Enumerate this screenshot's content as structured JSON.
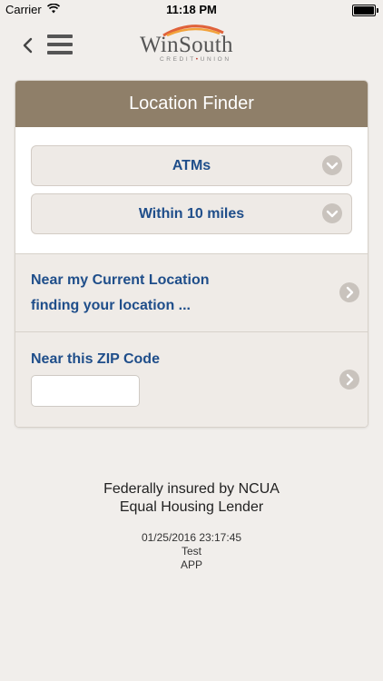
{
  "status_bar": {
    "carrier": "Carrier",
    "time": "11:18 PM",
    "battery_percent": "",
    "battery_level": 1.0
  },
  "logo": {
    "name": "WinSouth",
    "subtitle_left": "CREDIT",
    "subtitle_dot": "•",
    "subtitle_right": "UNION"
  },
  "card": {
    "title": "Location Finder",
    "select_type": {
      "value": "ATMs"
    },
    "select_distance": {
      "value": "Within 10 miles"
    },
    "current_location": {
      "title": "Near my Current Location",
      "status": "finding your location ..."
    },
    "zip": {
      "title": "Near this ZIP Code",
      "value": ""
    }
  },
  "footer": {
    "line1": "Federally insured by NCUA",
    "line2": "Equal Housing Lender",
    "timestamp": "01/25/2016 23:17:45",
    "env": "Test",
    "app": "APP"
  },
  "colors": {
    "header_bg": "#8f7f69",
    "link_blue": "#1f4e8a",
    "page_bg": "#f1eeeb"
  }
}
